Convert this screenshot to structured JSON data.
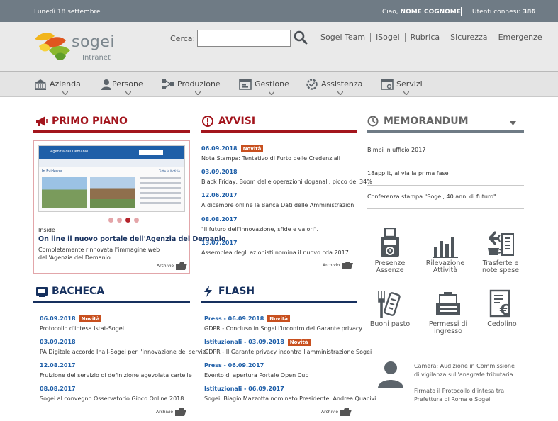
{
  "topbar": {
    "date": "Lunedì 18 settembre",
    "greeting": "Ciao,",
    "user": "NOME COGNOME",
    "users_label": "Utenti connesi:",
    "users_count": "386"
  },
  "header": {
    "brand": "sogei",
    "sub": "Intranet",
    "search_label": "Cerca:",
    "search_value": "",
    "links": [
      "Sogei Team",
      "iSogei",
      "Rubrica",
      "Sicurezza",
      "Emergenze"
    ]
  },
  "nav": [
    {
      "label": "Azienda",
      "icon": "building-icon"
    },
    {
      "label": "Persone",
      "icon": "person-icon"
    },
    {
      "label": "Produzione",
      "icon": "network-icon"
    },
    {
      "label": "Gestione",
      "icon": "window-icon"
    },
    {
      "label": "Assistenza",
      "icon": "gear-check-icon"
    },
    {
      "label": "Servizi",
      "icon": "browser-icon"
    }
  ],
  "primo_piano": {
    "title": "PRIMO PIANO",
    "mini_title": "Agenzia del Demanio",
    "mini_section": "In Evidenza",
    "mini_link": "Tutte le Notizie",
    "kicker": "Inside",
    "headline": "On line il nuovo portale dell'Agenzia del Demanio",
    "desc": "Completamente rinnovata l'immagine web dell'Agenzia del Demanio.",
    "archivio": "Archivio"
  },
  "avvisi": {
    "title": "AVVISI",
    "archivio": "Archivio",
    "items": [
      {
        "date": "06.09.2018",
        "badge": "Novità",
        "text": "Nota Stampa: Tentativo di Furto delle Credenziali"
      },
      {
        "date": "03.09.2018",
        "badge": "",
        "text": "Black Friday, Boom delle operazioni doganali, picco del 34%"
      },
      {
        "date": "12.06.2017",
        "badge": "",
        "text": "A dicembre online la Banca Dati delle Amministrazioni"
      },
      {
        "date": "08.08.2017",
        "badge": "",
        "text": "\"Il futuro dell'innovazione, sfide e valori\"."
      },
      {
        "date": "13.07.2017",
        "badge": "",
        "text": "Assemblea degli azionisti nomina il nuovo cda 2017"
      }
    ]
  },
  "memorandum": {
    "title": "MEMORANDUM",
    "items": [
      "Bimbi in ufficio 2017",
      "18app.it, al via la prima fase",
      "Conferenza stampa \"Sogei, 40 anni di futuro\""
    ]
  },
  "tools": [
    {
      "label1": "Presenze",
      "label2": "Assenze",
      "icon": "badge-reader-icon"
    },
    {
      "label1": "Rilevazione",
      "label2": "Attività",
      "icon": "bar-chart-icon"
    },
    {
      "label1": "Trasferte e",
      "label2": "note spese",
      "icon": "travel-icon"
    },
    {
      "label1": "Buoni pasto",
      "label2": "",
      "icon": "meal-voucher-icon"
    },
    {
      "label1": "Permessi di",
      "label2": "ingresso",
      "icon": "access-permit-icon"
    },
    {
      "label1": "Cedolino",
      "label2": "",
      "icon": "payslip-icon"
    }
  ],
  "bacheca": {
    "title": "BACHECA",
    "archivio": "Archivio",
    "items": [
      {
        "date": "06.09.2018",
        "badge": "Novità",
        "text": "Protocollo d'intesa Istat-Sogei"
      },
      {
        "date": "03.09.2018",
        "badge": "",
        "text": "PA Digitale accordo Inail-Sogei per l'innovazione dei servizi"
      },
      {
        "date": "12.08.2017",
        "badge": "",
        "text": "Fruizione del servizio di definizione agevolata cartelle"
      },
      {
        "date": "08.08.2017",
        "badge": "",
        "text": "Sogei al convegno Osservatorio Gioco Online 2018"
      }
    ]
  },
  "flash": {
    "title": "FLASH",
    "archivio": "Archivio",
    "items": [
      {
        "date": "Press - 06.09.2018",
        "badge": "Novità",
        "text": "GDPR - Concluso in Sogei l'incontro del Garante privacy"
      },
      {
        "date": "Istituzionali - 03.09.2018",
        "badge": "Novità",
        "text": "GDPR - Il Garante privacy incontra l'amministrazione Sogei"
      },
      {
        "date": "Press - 06.09.2017",
        "badge": "",
        "text": "Evento di apertura Portale Open Cup"
      },
      {
        "date": "Istituzionali - 06.09.2017",
        "badge": "",
        "text": "Sogei: Biagio Mazzotta nominato Presidente. Andrea Quacivi"
      }
    ]
  },
  "camera": {
    "line1": "Camera: Audizione in Commissione",
    "line2": "di vigilanza sull'anagrafe tributaria",
    "line3": "Firmato il Protocollo d'intesa tra",
    "line4": "Prefettura di Roma e Sogei"
  },
  "colors": {
    "red": "#a3151d",
    "navy": "#16305e",
    "badge": "#c8501f",
    "topbar": "#6f7b85"
  }
}
